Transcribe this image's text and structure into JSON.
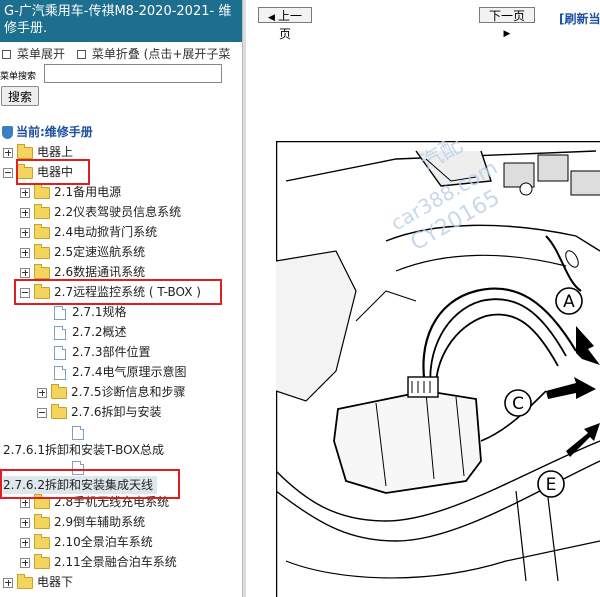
{
  "sidebar": {
    "title": "G-广汽乘用车-传祺M8-2020-2021- 维修手册.",
    "expand_label": "菜单展开",
    "collapse_label": "菜单折叠 (点击+展开子菜",
    "search_label": "菜单搜索",
    "search_value": "",
    "search_button": "搜索",
    "current": "当前:维修手册",
    "tree": {
      "n1": "电器上",
      "n2": "电器中",
      "n3": "2.1备用电源",
      "n4": "2.2仪表驾驶员信息系统",
      "n5": "2.4电动掀背门系统",
      "n6": "2.5定速巡航系统",
      "n7": "2.6数据通讯系统",
      "n8": "2.7远程监控系统 ( T-BOX )",
      "n9": "2.7.1规格",
      "n10": "2.7.2概述",
      "n11": "2.7.3部件位置",
      "n12": "2.7.4电气原理示意图",
      "n13": "2.7.5诊断信息和步骤",
      "n14": "2.7.6拆卸与安装",
      "n15": "2.7.6.1拆卸和安装T-BOX总成",
      "n16": "2.7.6.2拆卸和安装集成天线",
      "n17": "2.8手机无线充电系统",
      "n18": "2.9倒车辅助系统",
      "n19": "2.10全景泊车系统",
      "n20": "2.11全景融合泊车系统",
      "n21": "电器下"
    }
  },
  "toolbar": {
    "prev_label": "上一页",
    "next_label": "下一页",
    "refresh_label": "[刷新当"
  },
  "diagram": {
    "callouts": [
      "A",
      "C",
      "E"
    ],
    "watermark_line1": "汽配",
    "watermark_line2": "car388.com",
    "watermark_line3": "CY20165"
  },
  "colors": {
    "title_bar": "#1d6f8f",
    "highlight_box": "#e02020",
    "link_blue": "#1d4fa0"
  }
}
